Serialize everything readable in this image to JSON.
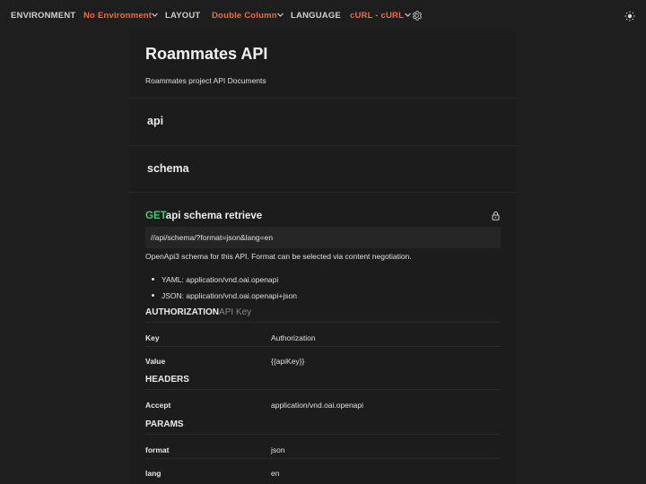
{
  "topbar": {
    "environment_label": "ENVIRONMENT",
    "environment_value": "No Environment",
    "layout_label": "LAYOUT",
    "layout_value": "Double Column",
    "language_label": "LANGUAGE",
    "language_value": "cURL - cURL",
    "accent_color": "#f26b3a",
    "icons": [
      "chevron-down-icon",
      "gear-icon",
      "sun-icon"
    ]
  },
  "doc": {
    "title": "Roammates API",
    "subtitle": "Roammates project API Documents"
  },
  "folders": [
    "api",
    "schema"
  ],
  "request": {
    "method": "GET",
    "method_color": "#3ec97a",
    "name": "api schema retrieve",
    "url": "//api/schema/?format=json&lang=en",
    "description": "OpenApi3 schema for this API. Format can be selected via content negotiation.",
    "bullets": [
      "YAML: application/vnd.oai.openapi",
      "JSON: application/vnd.oai.openapi+json"
    ],
    "lock_icon": "lock-icon"
  },
  "authorization": {
    "heading": "AUTHORIZATION",
    "type": "API Key",
    "rows": [
      {
        "key": "Key",
        "value": "Authorization"
      },
      {
        "key": "Value",
        "value": "{{apiKey}}"
      }
    ]
  },
  "headers": {
    "heading": "HEADERS",
    "rows": [
      {
        "key": "Accept",
        "value": "application/vnd.oai.openapi"
      }
    ]
  },
  "params": {
    "heading": "PARAMS",
    "rows": [
      {
        "key": "format",
        "value": "json"
      },
      {
        "key": "lang",
        "value": "en"
      }
    ]
  }
}
